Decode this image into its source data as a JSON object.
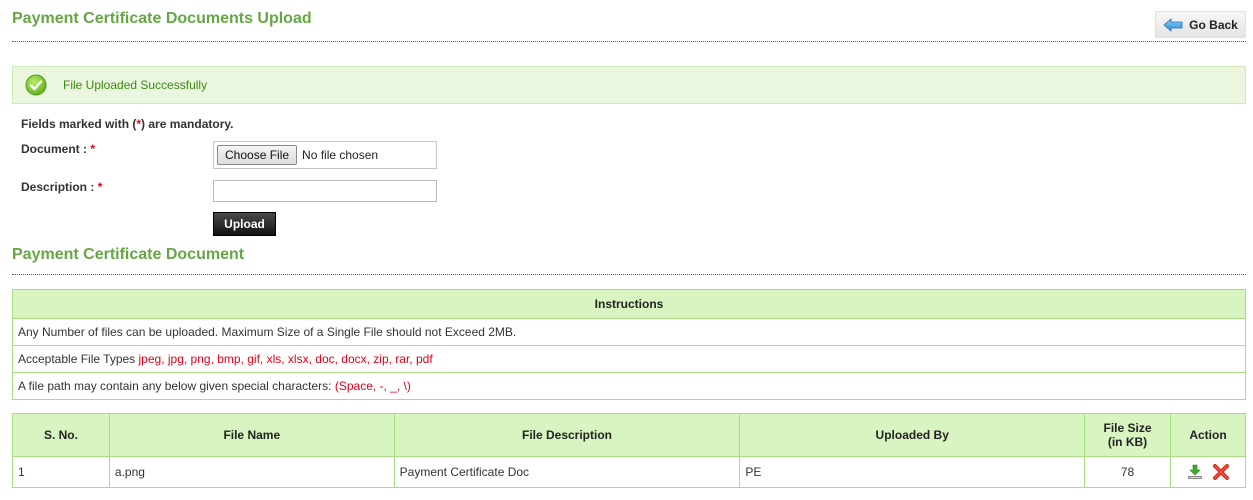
{
  "header": {
    "title": "Payment Certificate Documents Upload",
    "go_back_label": "Go Back"
  },
  "alert": {
    "message": "File Uploaded Successfully"
  },
  "form": {
    "mandatory_note_prefix": "Fields marked with (",
    "mandatory_note_star": "*",
    "mandatory_note_suffix": ") are mandatory.",
    "document_label": "Document :",
    "document_button": "Choose File",
    "document_status": "No file chosen",
    "description_label": "Description :",
    "description_value": "",
    "required_mark": "*",
    "upload_label": "Upload"
  },
  "section": {
    "title": "Payment Certificate Document"
  },
  "instructions": {
    "heading": "Instructions",
    "line1": "Any Number of files can be uploaded. Maximum Size of a Single File should not Exceed 2MB.",
    "line2_prefix": "Acceptable File Types ",
    "line2_types": "jpeg, jpg, png, bmp, gif, xls, xlsx, doc, docx, zip, rar, pdf",
    "line3_prefix": "A file path may contain any below given special characters: ",
    "line3_chars": "(Space, -, _, \\)"
  },
  "files_table": {
    "headers": {
      "sno": "S. No.",
      "file_name": "File Name",
      "file_description": "File Description",
      "uploaded_by": "Uploaded By",
      "file_size_line1": "File Size",
      "file_size_line2": "(in KB)",
      "action": "Action"
    },
    "rows": [
      {
        "sno": "1",
        "file_name": "a.png",
        "file_description": "Payment Certificate Doc",
        "uploaded_by": "PE",
        "file_size": "78"
      }
    ]
  },
  "colors": {
    "accent_green": "#66a745",
    "success_text": "#3a8a10",
    "header_bg": "#d8f5c1",
    "border_green": "#a8dd86",
    "required_red": "#e0001b"
  },
  "icons": {
    "go_back": "left-arrow-icon",
    "success": "check-circle-icon",
    "download": "download-icon",
    "delete": "delete-icon"
  }
}
